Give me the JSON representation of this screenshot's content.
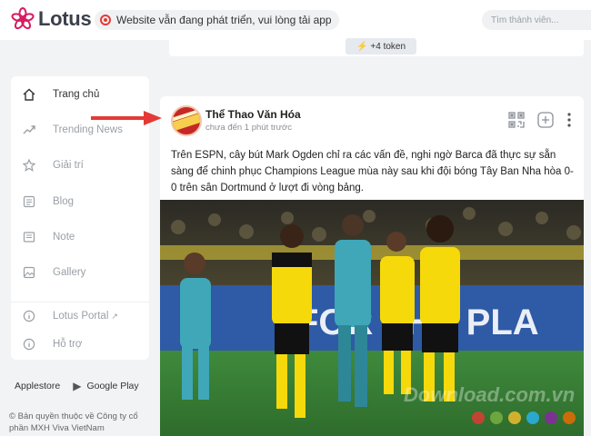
{
  "header": {
    "logo_text": "Lotus",
    "notice": "Website vẫn đang phát triển, vui lòng tải app",
    "search_placeholder": "Tìm thành viên..."
  },
  "prev_post": {
    "token_label": "+4 token"
  },
  "sidebar": {
    "items": [
      {
        "label": "Trang chủ",
        "icon": "home-icon"
      },
      {
        "label": "Trending News",
        "icon": "trending-icon"
      },
      {
        "label": "Giải trí",
        "icon": "star-icon"
      },
      {
        "label": "Blog",
        "icon": "blog-icon"
      },
      {
        "label": "Note",
        "icon": "note-icon"
      },
      {
        "label": "Gallery",
        "icon": "gallery-icon"
      },
      {
        "label": "Lotus Portal",
        "icon": "info-icon"
      },
      {
        "label": "Hỗ trợ",
        "icon": "info-icon"
      }
    ],
    "stores": [
      "Applestore",
      "Google Play"
    ],
    "copyright": "© Bản quyền thuộc về Công ty cổ phần MXH Viva VietNam"
  },
  "post": {
    "author": "Thể Thao Văn Hóa",
    "timestamp": "chưa đến 1 phút trước",
    "text": "Trên ESPN, cây bút Mark Ogden chỉ ra các vấn đề, nghi ngờ Barca đã thực sự sẵn sàng để chinh phục Champions League mùa này sau khi đội bóng Tây Ban Nha hòa 0-0 trên sân Dortmund ở lượt đi vòng bảng.",
    "image_banner": "FOR THE PLA",
    "watermark": "Download.com.vn",
    "icons": [
      "qr-code-icon",
      "add-icon",
      "more-options-icon"
    ]
  },
  "colors": {
    "brand": "#d81b60",
    "arrow": "#e53935",
    "dortmund_yellow": "#f5d90a",
    "barca_teal": "#3fa7b8"
  }
}
